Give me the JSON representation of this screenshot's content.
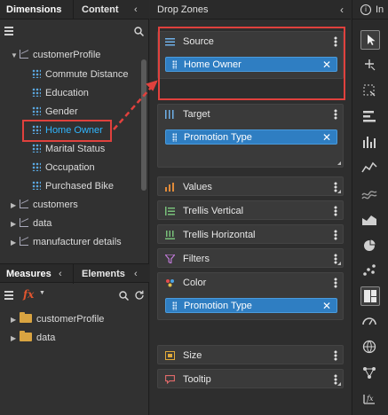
{
  "left_panel": {
    "tabs": {
      "dimensions": "Dimensions",
      "content": "Content"
    },
    "tree": [
      {
        "label": "customerProfile",
        "kind": "hierarchy",
        "expanded": true
      },
      {
        "label": "Commute Distance",
        "kind": "dimension"
      },
      {
        "label": "Education",
        "kind": "dimension"
      },
      {
        "label": "Gender",
        "kind": "dimension"
      },
      {
        "label": "Home Owner",
        "kind": "dimension",
        "selected": true
      },
      {
        "label": "Marital Status",
        "kind": "dimension"
      },
      {
        "label": "Occupation",
        "kind": "dimension"
      },
      {
        "label": "Purchased Bike",
        "kind": "dimension"
      },
      {
        "label": "customers",
        "kind": "hierarchy"
      },
      {
        "label": "data",
        "kind": "hierarchy"
      },
      {
        "label": "manufacturer details",
        "kind": "hierarchy"
      }
    ],
    "bottom_tabs": {
      "measures": "Measures",
      "elements": "Elements"
    },
    "bottom_tree": [
      {
        "label": "customerProfile",
        "kind": "folder"
      },
      {
        "label": "data",
        "kind": "folder"
      }
    ]
  },
  "drop_zones": {
    "title": "Drop Zones",
    "zones": [
      {
        "label": "Source",
        "icon": "list-icon",
        "item": "Home Owner"
      },
      {
        "label": "Target",
        "icon": "bars-icon",
        "item": "Promotion Type"
      },
      {
        "label": "Values",
        "icon": "bar-chart-icon"
      },
      {
        "label": "Trellis Vertical",
        "icon": "trellis-vertical-icon"
      },
      {
        "label": "Trellis Horizontal",
        "icon": "trellis-horizontal-icon"
      },
      {
        "label": "Filters",
        "icon": "funnel-icon"
      },
      {
        "label": "Color",
        "icon": "palette-icon",
        "item": "Promotion Type"
      },
      {
        "label": "Size",
        "icon": "size-icon"
      },
      {
        "label": "Tooltip",
        "icon": "tooltip-icon"
      }
    ]
  },
  "right_toolbar": {
    "label": "In"
  },
  "colors": {
    "accent": "#2f7ec2",
    "highlight": "#e0413d",
    "selected_text": "#2fb6ff"
  }
}
